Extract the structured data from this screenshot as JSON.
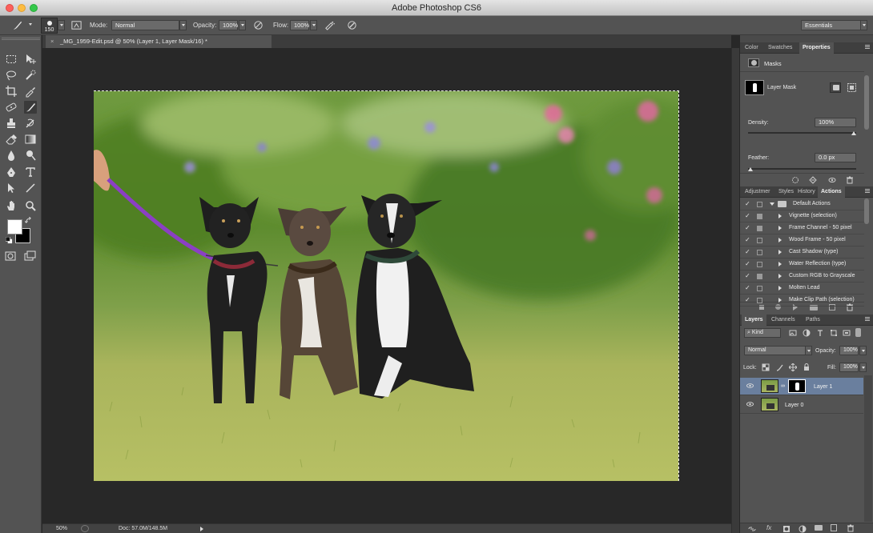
{
  "app": {
    "title": "Adobe Photoshop CS6"
  },
  "options_bar": {
    "brush_size": "150",
    "mode_label": "Mode:",
    "mode_value": "Normal",
    "opacity_label": "Opacity:",
    "opacity_value": "100%",
    "flow_label": "Flow:",
    "flow_value": "100%",
    "workspace": "Essentials"
  },
  "document": {
    "tab_title": "_MG_1959-Edit.psd @ 50% (Layer 1, Layer Mask/16) *",
    "tab_close": "×"
  },
  "status_bar": {
    "zoom": "50%",
    "doc_info": "Doc: 57.0M/148.5M"
  },
  "properties_panel": {
    "tabs": [
      "Color",
      "Swatches",
      "Properties"
    ],
    "active_tab": "Properties",
    "section": "Masks",
    "mask_label": "Layer Mask",
    "density_label": "Density:",
    "density_value": "100%",
    "density": 1.0,
    "feather_label": "Feather:",
    "feather_value": "0.0 px",
    "feather": 0.0
  },
  "actions_panel": {
    "tabs": [
      "Adjustmer",
      "Styles",
      "History",
      "Actions"
    ],
    "active_tab": "Actions",
    "set_name": "Default Actions",
    "actions": [
      {
        "label": "Vignette (selection)",
        "dialog": true
      },
      {
        "label": "Frame Channel - 50 pixel",
        "dialog": true
      },
      {
        "label": "Wood Frame - 50 pixel",
        "dialog": false
      },
      {
        "label": "Cast Shadow (type)",
        "dialog": false
      },
      {
        "label": "Water Reflection (type)",
        "dialog": false
      },
      {
        "label": "Custom RGB to Grayscale",
        "dialog": true
      },
      {
        "label": "Molten Lead",
        "dialog": false
      },
      {
        "label": "Make Clip Path (selection)",
        "dialog": false
      }
    ]
  },
  "layers_panel": {
    "tabs": [
      "Layers",
      "Channels",
      "Paths"
    ],
    "active_tab": "Layers",
    "filter_kind": "Kind",
    "blend_mode": "Normal",
    "opacity_label": "Opacity:",
    "opacity_value": "100%",
    "lock_label": "Lock:",
    "fill_label": "Fill:",
    "fill_value": "100%",
    "layers": [
      {
        "name": "Layer 1",
        "selected": true,
        "has_mask": true
      },
      {
        "name": "Layer 0",
        "selected": false,
        "has_mask": false
      }
    ]
  },
  "colors": {
    "panel_bg": "#535353",
    "canvas_bg": "#282828",
    "selected_layer": "#6a7f9e",
    "brush_stroke_purple": "#8b3fc4"
  }
}
